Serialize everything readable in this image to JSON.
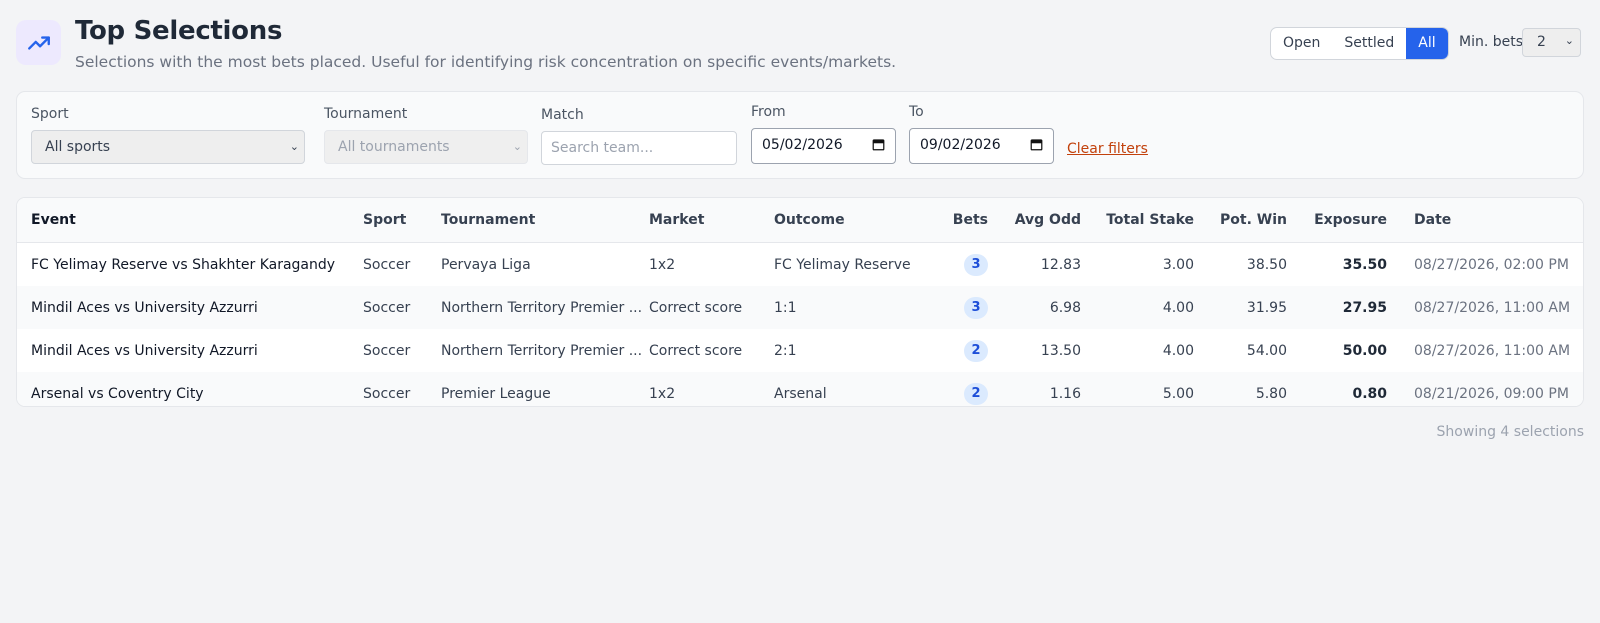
{
  "header": {
    "title": "Top Selections",
    "subtitle": "Selections with the most bets placed. Useful for identifying risk concentration on specific events/markets.",
    "logo_icon": "trending-up-icon"
  },
  "status_filter": {
    "options": [
      "Open",
      "Settled",
      "All"
    ],
    "active": "All"
  },
  "min_bets": {
    "label": "Min. bets",
    "value": "2"
  },
  "filters": {
    "sport_label": "Sport",
    "sport_value": "All sports",
    "tournament_label": "Tournament",
    "tournament_value": "All tournaments",
    "match_label": "Match",
    "match_placeholder": "Search team...",
    "from_label": "From",
    "from_value": "05/02/2026",
    "to_label": "To",
    "to_value": "09/02/2026",
    "clear_label": "Clear filters"
  },
  "table": {
    "columns": [
      "Event",
      "Sport",
      "Tournament",
      "Market",
      "Outcome",
      "Bets",
      "Avg Odd",
      "Total Stake",
      "Pot. Win",
      "Exposure",
      "Date"
    ],
    "rows": [
      [
        "FC Yelimay Reserve vs Shakhter Karagandy",
        "Soccer",
        "Pervaya Liga",
        "1x2",
        "FC Yelimay Reserve",
        "3",
        "12.83",
        "3.00",
        "38.50",
        "35.50",
        "08/27/2026, 02:00 PM"
      ],
      [
        "Mindil Aces vs University Azzurri",
        "Soccer",
        "Northern Territory Premier ...",
        "Correct score",
        "1:1",
        "3",
        "6.98",
        "4.00",
        "31.95",
        "27.95",
        "08/27/2026, 11:00 AM"
      ],
      [
        "Mindil Aces vs University Azzurri",
        "Soccer",
        "Northern Territory Premier ...",
        "Correct score",
        "2:1",
        "2",
        "13.50",
        "4.00",
        "54.00",
        "50.00",
        "08/27/2026, 11:00 AM"
      ],
      [
        "Arsenal vs Coventry City",
        "Soccer",
        "Premier League",
        "1x2",
        "Arsenal",
        "2",
        "1.16",
        "5.00",
        "5.80",
        "0.80",
        "08/21/2026, 09:00 PM"
      ]
    ]
  },
  "footer": {
    "count_text": "Showing 4 selections"
  },
  "colors": {
    "accent": "#2563eb",
    "clear_link": "#c2410c",
    "badge_bg": "#dbeafe"
  }
}
